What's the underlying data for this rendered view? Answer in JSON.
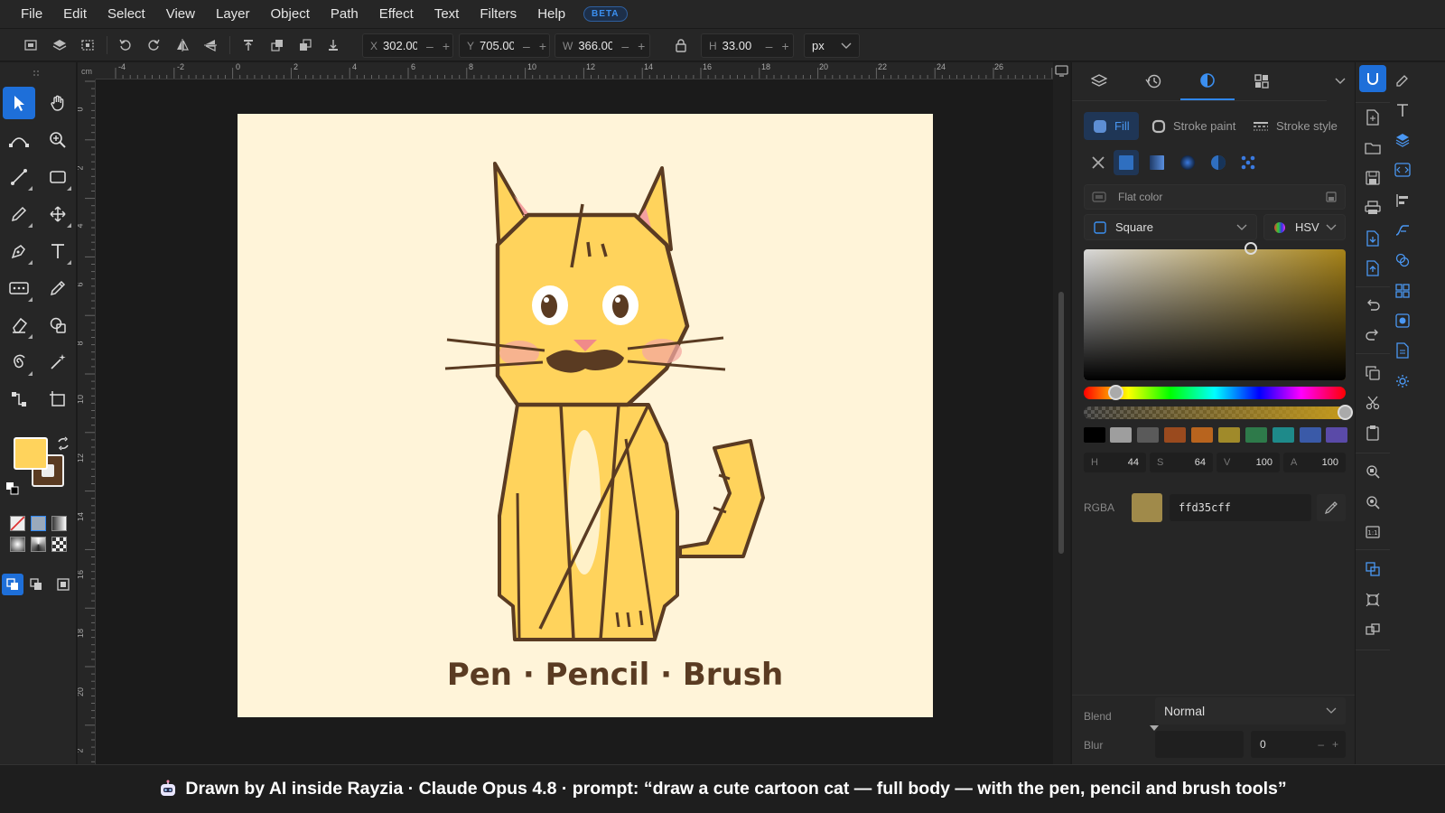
{
  "menu": {
    "items": [
      "File",
      "Edit",
      "Select",
      "View",
      "Layer",
      "Object",
      "Path",
      "Effect",
      "Text",
      "Filters",
      "Help"
    ],
    "badge": "BETA"
  },
  "toolbar": {
    "x_label": "X",
    "x_value": "302.00",
    "y_label": "Y",
    "y_value": "705.00",
    "w_label": "W",
    "w_value": "366.00",
    "h_label": "H",
    "h_value": "33.00",
    "unit": "px",
    "minus": "–",
    "plus": "+"
  },
  "ruler": {
    "corner_unit": "cm",
    "top_ticks": [
      "-4",
      "-2",
      "0",
      "2",
      "4",
      "6",
      "8",
      "10",
      "12",
      "14",
      "16",
      "18",
      "20",
      "22",
      "24",
      "26"
    ],
    "left_ticks": [
      "0",
      "2",
      "4",
      "6",
      "8",
      "10",
      "12",
      "14",
      "16",
      "18",
      "20",
      "2"
    ]
  },
  "canvas": {
    "background": "#fff4d9",
    "caption_text": "Pen · Pencil · Brush",
    "cat_fill": "#ffd35c",
    "outline": "#5a3b22"
  },
  "panel": {
    "subtabs": {
      "fill": "Fill",
      "stroke_paint": "Stroke paint",
      "stroke_style": "Stroke style"
    },
    "paint_mode": "Flat color",
    "picker_shape": "Square",
    "color_model": "HSV",
    "hsva": {
      "h_key": "H",
      "h": "44",
      "s_key": "S",
      "s": "64",
      "v_key": "V",
      "v": "100",
      "a_key": "A",
      "a": "100"
    },
    "rgba_label": "RGBA",
    "rgba_value": "ffd35cff",
    "preview_color": "#a08a4a",
    "swatches": [
      "#000000",
      "#9e9e9e",
      "#5a5a5a",
      "#9a4a1e",
      "#b8641e",
      "#a08a2a",
      "#2e7a4a",
      "#1e8a8a",
      "#3a5aa8",
      "#5a4aa8"
    ],
    "blend_label": "Blend",
    "blend_value": "Normal",
    "blur_label": "Blur",
    "blur_value": "0"
  },
  "footer": {
    "lead": "Drawn by AI",
    "rest": "inside Rayzia · Claude Opus 4.8 · prompt: “draw a cute cartoon cat — full body — with the pen, pencil and brush tools”"
  }
}
